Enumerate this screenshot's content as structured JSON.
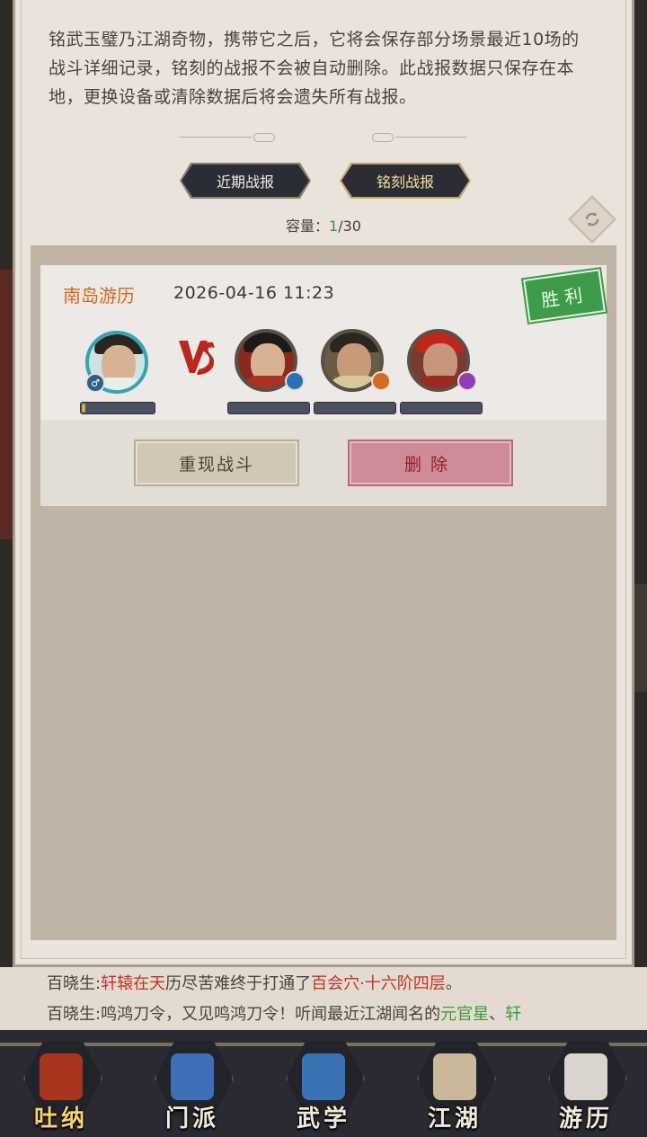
{
  "description": "铭武玉璧乃江湖奇物，携带它之后，它将会保存部分场景最近10场的战斗详细记录，铭刻的战报不会被自动删除。此战报数据只保存在本地，更换设备或清除数据后将会遗失所有战报。",
  "tabs": {
    "recent": "近期战报",
    "engraved": "铭刻战报",
    "active": "engraved"
  },
  "capacity": {
    "label": "容量：",
    "used": "1",
    "total": "/30"
  },
  "record": {
    "mode": "南岛游历",
    "time": "2026-04-16 11:23",
    "result": "胜利",
    "vs": "VS",
    "player": {
      "gender_icon": "♂",
      "hp_fraction": 0.05
    },
    "enemies": [
      {
        "badge_icon": "blue-orb-icon",
        "hp_fraction": 0
      },
      {
        "badge_icon": "orange-orb-icon",
        "hp_fraction": 0
      },
      {
        "badge_icon": "purple-orb-icon",
        "hp_fraction": 0
      }
    ],
    "replay_button": "重现战斗",
    "delete_button": "删除"
  },
  "chat": {
    "line1": {
      "speaker": "百晓生:",
      "name": "轩辕在天",
      "mid": "历尽苦难终于打通了",
      "place": "百会穴·十六阶四层",
      "end": "。"
    },
    "line2": {
      "speaker": "百晓生:",
      "text": "鸣鸿刀令，又见鸣鸿刀令！听闻最近江湖闻名的",
      "name": "元官星",
      "sep": "、",
      "name2": "轩"
    }
  },
  "nav": [
    {
      "label": "吐纳",
      "icon": "meditation-icon",
      "active": true
    },
    {
      "label": "门派",
      "icon": "sect-icon",
      "active": false
    },
    {
      "label": "武学",
      "icon": "martial-arts-icon",
      "active": false
    },
    {
      "label": "江湖",
      "icon": "jianghu-icon",
      "active": false
    },
    {
      "label": "游历",
      "icon": "travel-icon",
      "active": false
    }
  ],
  "colors": {
    "accent_orange": "#d0671f",
    "win_green": "#3e9b4a",
    "capacity_green": "#2f9a3a",
    "delete_red": "#cd8c98",
    "nav_bg": "#2a2a33"
  }
}
